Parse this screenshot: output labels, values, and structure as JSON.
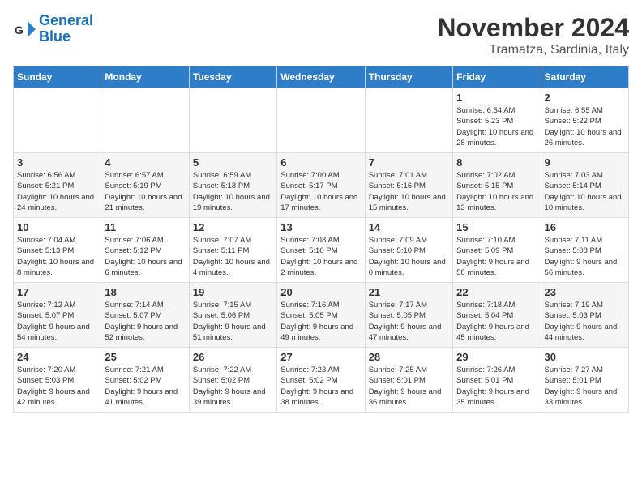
{
  "header": {
    "logo_line1": "General",
    "logo_line2": "Blue",
    "month": "November 2024",
    "location": "Tramatza, Sardinia, Italy"
  },
  "days_of_week": [
    "Sunday",
    "Monday",
    "Tuesday",
    "Wednesday",
    "Thursday",
    "Friday",
    "Saturday"
  ],
  "weeks": [
    [
      {
        "day": "",
        "info": ""
      },
      {
        "day": "",
        "info": ""
      },
      {
        "day": "",
        "info": ""
      },
      {
        "day": "",
        "info": ""
      },
      {
        "day": "",
        "info": ""
      },
      {
        "day": "1",
        "info": "Sunrise: 6:54 AM\nSunset: 5:23 PM\nDaylight: 10 hours\nand 28 minutes."
      },
      {
        "day": "2",
        "info": "Sunrise: 6:55 AM\nSunset: 5:22 PM\nDaylight: 10 hours\nand 26 minutes."
      }
    ],
    [
      {
        "day": "3",
        "info": "Sunrise: 6:56 AM\nSunset: 5:21 PM\nDaylight: 10 hours\nand 24 minutes."
      },
      {
        "day": "4",
        "info": "Sunrise: 6:57 AM\nSunset: 5:19 PM\nDaylight: 10 hours\nand 21 minutes."
      },
      {
        "day": "5",
        "info": "Sunrise: 6:59 AM\nSunset: 5:18 PM\nDaylight: 10 hours\nand 19 minutes."
      },
      {
        "day": "6",
        "info": "Sunrise: 7:00 AM\nSunset: 5:17 PM\nDaylight: 10 hours\nand 17 minutes."
      },
      {
        "day": "7",
        "info": "Sunrise: 7:01 AM\nSunset: 5:16 PM\nDaylight: 10 hours\nand 15 minutes."
      },
      {
        "day": "8",
        "info": "Sunrise: 7:02 AM\nSunset: 5:15 PM\nDaylight: 10 hours\nand 13 minutes."
      },
      {
        "day": "9",
        "info": "Sunrise: 7:03 AM\nSunset: 5:14 PM\nDaylight: 10 hours\nand 10 minutes."
      }
    ],
    [
      {
        "day": "10",
        "info": "Sunrise: 7:04 AM\nSunset: 5:13 PM\nDaylight: 10 hours\nand 8 minutes."
      },
      {
        "day": "11",
        "info": "Sunrise: 7:06 AM\nSunset: 5:12 PM\nDaylight: 10 hours\nand 6 minutes."
      },
      {
        "day": "12",
        "info": "Sunrise: 7:07 AM\nSunset: 5:11 PM\nDaylight: 10 hours\nand 4 minutes."
      },
      {
        "day": "13",
        "info": "Sunrise: 7:08 AM\nSunset: 5:10 PM\nDaylight: 10 hours\nand 2 minutes."
      },
      {
        "day": "14",
        "info": "Sunrise: 7:09 AM\nSunset: 5:10 PM\nDaylight: 10 hours\nand 0 minutes."
      },
      {
        "day": "15",
        "info": "Sunrise: 7:10 AM\nSunset: 5:09 PM\nDaylight: 9 hours\nand 58 minutes."
      },
      {
        "day": "16",
        "info": "Sunrise: 7:11 AM\nSunset: 5:08 PM\nDaylight: 9 hours\nand 56 minutes."
      }
    ],
    [
      {
        "day": "17",
        "info": "Sunrise: 7:12 AM\nSunset: 5:07 PM\nDaylight: 9 hours\nand 54 minutes."
      },
      {
        "day": "18",
        "info": "Sunrise: 7:14 AM\nSunset: 5:07 PM\nDaylight: 9 hours\nand 52 minutes."
      },
      {
        "day": "19",
        "info": "Sunrise: 7:15 AM\nSunset: 5:06 PM\nDaylight: 9 hours\nand 51 minutes."
      },
      {
        "day": "20",
        "info": "Sunrise: 7:16 AM\nSunset: 5:05 PM\nDaylight: 9 hours\nand 49 minutes."
      },
      {
        "day": "21",
        "info": "Sunrise: 7:17 AM\nSunset: 5:05 PM\nDaylight: 9 hours\nand 47 minutes."
      },
      {
        "day": "22",
        "info": "Sunrise: 7:18 AM\nSunset: 5:04 PM\nDaylight: 9 hours\nand 45 minutes."
      },
      {
        "day": "23",
        "info": "Sunrise: 7:19 AM\nSunset: 5:03 PM\nDaylight: 9 hours\nand 44 minutes."
      }
    ],
    [
      {
        "day": "24",
        "info": "Sunrise: 7:20 AM\nSunset: 5:03 PM\nDaylight: 9 hours\nand 42 minutes."
      },
      {
        "day": "25",
        "info": "Sunrise: 7:21 AM\nSunset: 5:02 PM\nDaylight: 9 hours\nand 41 minutes."
      },
      {
        "day": "26",
        "info": "Sunrise: 7:22 AM\nSunset: 5:02 PM\nDaylight: 9 hours\nand 39 minutes."
      },
      {
        "day": "27",
        "info": "Sunrise: 7:23 AM\nSunset: 5:02 PM\nDaylight: 9 hours\nand 38 minutes."
      },
      {
        "day": "28",
        "info": "Sunrise: 7:25 AM\nSunset: 5:01 PM\nDaylight: 9 hours\nand 36 minutes."
      },
      {
        "day": "29",
        "info": "Sunrise: 7:26 AM\nSunset: 5:01 PM\nDaylight: 9 hours\nand 35 minutes."
      },
      {
        "day": "30",
        "info": "Sunrise: 7:27 AM\nSunset: 5:01 PM\nDaylight: 9 hours\nand 33 minutes."
      }
    ]
  ]
}
